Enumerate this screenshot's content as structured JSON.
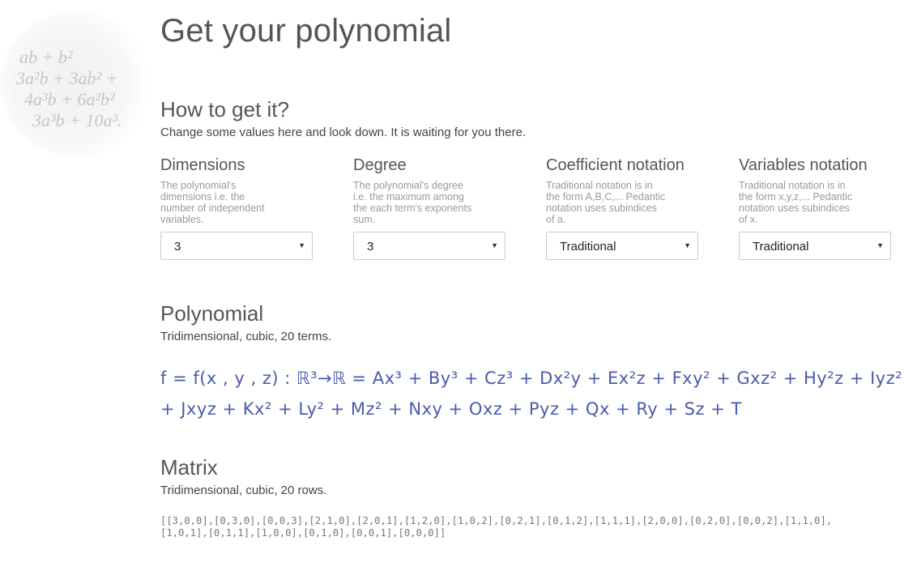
{
  "logo": {
    "lines": [
      "ab + b²",
      "3a²b + 3ab² +",
      "4a³b + 6a²b²",
      "3a³b + 10a³."
    ]
  },
  "page": {
    "title": "Get your polynomial"
  },
  "how": {
    "heading": "How to get it?",
    "subtitle": "Change some values here and look down. It is waiting for you there."
  },
  "options": [
    {
      "label": "Dimensions",
      "description": "The polynomial's dimensions i.e. the number of independent variables.",
      "value": "3"
    },
    {
      "label": "Degree",
      "description": "The polynomial's degree i.e. the maximum among the each term's exponents sum.",
      "value": "3"
    },
    {
      "label": "Coefficient notation",
      "description": "Traditional notation is in the form A,B,C,... Pedantic notation uses subindices of a.",
      "value": "Traditional"
    },
    {
      "label": "Variables notation",
      "description": "Traditional notation is in the form x,y,z,... Pedantic notation uses subindices of x.",
      "value": "Traditional"
    }
  ],
  "polynomial": {
    "heading": "Polynomial",
    "subtitle": "Tridimensional, cubic, 20 terms.",
    "formula_line1": "f = f(x , y , z) : ℝ³→ℝ  =  Ax³ + By³ + Cz³ + Dx²y + Ex²z + Fxy² + Gxz² + Hy²z + Iyz²",
    "formula_line2": "+ Jxyz + Kx² + Ly² + Mz² + Nxy + Oxz + Pyz + Qx + Ry + Sz + T"
  },
  "matrix": {
    "heading": "Matrix",
    "subtitle": "Tridimensional, cubic, 20 rows.",
    "line1": "[[3,0,0],[0,3,0],[0,0,3],[2,1,0],[2,0,1],[1,2,0],[1,0,2],[0,2,1],[0,1,2],[1,1,1],[2,0,0],[0,2,0],[0,0,2],[1,1,0],",
    "line2": "[1,0,1],[0,1,1],[1,0,0],[0,1,0],[0,0,1],[0,0,0]]"
  },
  "colors": {
    "formula": "#4a5bab",
    "heading": "#555555",
    "muted": "#999999"
  }
}
